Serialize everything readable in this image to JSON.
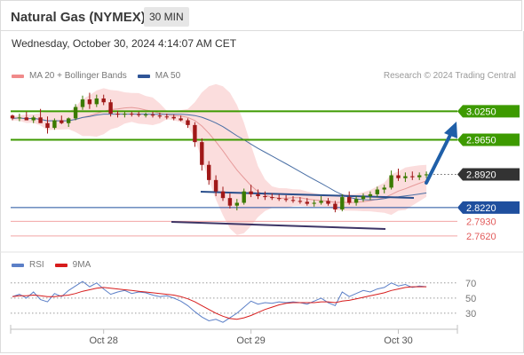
{
  "header": {
    "title": "Natural Gas (NYMEX)",
    "interval": "30 MIN"
  },
  "timestamp": "Wednesday, October 30, 2024 4:14:07 AM CET",
  "legend": {
    "ma20_label": "MA 20 + Bollinger Bands",
    "ma50_label": "MA 50",
    "credit": "Research © 2024 Trading Central"
  },
  "rsi_legend": {
    "rsi_label": "RSI",
    "ma_label": "9MA"
  },
  "colors": {
    "resistance": "#3d9a00",
    "support": "#1f4f9e",
    "secondary_support": "#e25c5c",
    "bollinger_fill": "#fad2d2",
    "ma20": "#e69a9a",
    "ma50": "#4a6fa5",
    "arrow": "#1f5fa8",
    "candle_up": "#3a7a00",
    "candle_down": "#a01818",
    "rsi_line": "#5b7fc7",
    "rsi_ma": "#d71c1c"
  },
  "chart_data": [
    {
      "type": "line",
      "subtype": "candlestick",
      "x_ticks": [
        "Oct 28",
        "Oct 29",
        "Oct 30"
      ],
      "ylim": [
        2.73,
        3.08
      ],
      "levels": [
        {
          "label": "3.0250",
          "value": 3.025,
          "kind": "resistance"
        },
        {
          "label": "2.9650",
          "value": 2.965,
          "kind": "resistance"
        },
        {
          "label": "2.8920",
          "value": 2.892,
          "kind": "last"
        },
        {
          "label": "2.8220",
          "value": 2.822,
          "kind": "support"
        },
        {
          "label": "2.7930",
          "value": 2.793,
          "kind": "secondary_support"
        },
        {
          "label": "2.7620",
          "value": 2.762,
          "kind": "secondary_support"
        }
      ],
      "candles": [
        [
          0,
          3.016,
          3.018,
          3.006,
          3.01
        ],
        [
          1,
          3.01,
          3.02,
          3.004,
          3.012
        ],
        [
          2,
          3.012,
          3.024,
          3.006,
          3.006
        ],
        [
          3,
          3.006,
          3.016,
          3.0,
          3.012
        ],
        [
          4,
          3.012,
          3.03,
          3.008,
          3.0
        ],
        [
          5,
          3.0,
          3.014,
          2.978,
          2.99
        ],
        [
          6,
          2.99,
          3.01,
          2.986,
          3.006
        ],
        [
          7,
          3.006,
          3.016,
          2.998,
          3.0
        ],
        [
          8,
          3.0,
          3.012,
          2.992,
          3.01
        ],
        [
          9,
          3.01,
          3.04,
          3.006,
          3.034
        ],
        [
          10,
          3.034,
          3.058,
          3.028,
          3.05
        ],
        [
          11,
          3.05,
          3.064,
          3.03,
          3.04
        ],
        [
          12,
          3.04,
          3.06,
          3.034,
          3.052
        ],
        [
          13,
          3.052,
          3.06,
          3.038,
          3.044
        ],
        [
          14,
          3.044,
          3.05,
          3.014,
          3.02
        ],
        [
          15,
          3.02,
          3.026,
          3.012,
          3.018
        ],
        [
          16,
          3.018,
          3.024,
          3.012,
          3.02
        ],
        [
          17,
          3.02,
          3.024,
          3.014,
          3.019
        ],
        [
          18,
          3.019,
          3.024,
          3.013,
          3.017
        ],
        [
          19,
          3.017,
          3.022,
          3.012,
          3.018
        ],
        [
          20,
          3.018,
          3.024,
          3.012,
          3.016
        ],
        [
          21,
          3.016,
          3.022,
          3.01,
          3.014
        ],
        [
          22,
          3.014,
          3.02,
          3.008,
          3.013
        ],
        [
          23,
          3.013,
          3.018,
          3.006,
          3.01
        ],
        [
          24,
          3.01,
          3.016,
          3.004,
          3.006
        ],
        [
          25,
          3.006,
          3.01,
          2.99,
          2.996
        ],
        [
          26,
          2.996,
          3.002,
          2.95,
          2.96
        ],
        [
          27,
          2.96,
          2.968,
          2.9,
          2.912
        ],
        [
          28,
          2.912,
          2.92,
          2.87,
          2.88
        ],
        [
          29,
          2.88,
          2.89,
          2.846,
          2.856
        ],
        [
          30,
          2.856,
          2.866,
          2.836,
          2.842
        ],
        [
          31,
          2.842,
          2.852,
          2.82,
          2.826
        ],
        [
          32,
          2.826,
          2.84,
          2.816,
          2.832
        ],
        [
          33,
          2.832,
          2.862,
          2.828,
          2.856
        ],
        [
          34,
          2.856,
          2.87,
          2.844,
          2.85
        ],
        [
          35,
          2.85,
          2.86,
          2.84,
          2.846
        ],
        [
          36,
          2.846,
          2.856,
          2.838,
          2.844
        ],
        [
          37,
          2.844,
          2.852,
          2.838,
          2.842
        ],
        [
          38,
          2.842,
          2.85,
          2.836,
          2.84
        ],
        [
          39,
          2.84,
          2.848,
          2.834,
          2.838
        ],
        [
          40,
          2.838,
          2.846,
          2.832,
          2.836
        ],
        [
          41,
          2.836,
          2.844,
          2.83,
          2.834
        ],
        [
          42,
          2.834,
          2.842,
          2.826,
          2.83
        ],
        [
          43,
          2.83,
          2.838,
          2.824,
          2.832
        ],
        [
          44,
          2.832,
          2.846,
          2.828,
          2.836
        ],
        [
          45,
          2.836,
          2.842,
          2.826,
          2.83
        ],
        [
          46,
          2.83,
          2.836,
          2.812,
          2.818
        ],
        [
          47,
          2.818,
          2.85,
          2.814,
          2.844
        ],
        [
          48,
          2.844,
          2.856,
          2.828,
          2.832
        ],
        [
          49,
          2.832,
          2.846,
          2.826,
          2.84
        ],
        [
          50,
          2.84,
          2.852,
          2.834,
          2.846
        ],
        [
          51,
          2.846,
          2.856,
          2.838,
          2.85
        ],
        [
          52,
          2.85,
          2.866,
          2.844,
          2.86
        ],
        [
          53,
          2.86,
          2.87,
          2.852,
          2.864
        ],
        [
          54,
          2.864,
          2.9,
          2.86,
          2.89
        ],
        [
          55,
          2.89,
          2.904,
          2.878,
          2.884
        ],
        [
          56,
          2.884,
          2.896,
          2.876,
          2.888
        ],
        [
          57,
          2.888,
          2.898,
          2.88,
          2.886
        ],
        [
          58,
          2.886,
          2.896,
          2.88,
          2.89
        ],
        [
          59,
          2.89,
          2.898,
          2.884,
          2.892
        ]
      ]
    },
    {
      "type": "line",
      "title": "RSI",
      "ylim": [
        10,
        85
      ],
      "y_ticks": [
        70,
        50,
        30
      ],
      "series": [
        {
          "name": "RSI",
          "values": [
            52,
            55,
            50,
            58,
            48,
            45,
            56,
            52,
            60,
            66,
            72,
            65,
            70,
            62,
            55,
            58,
            60,
            56,
            58,
            57,
            54,
            52,
            53,
            50,
            46,
            40,
            32,
            25,
            20,
            22,
            18,
            24,
            30,
            38,
            46,
            42,
            44,
            43,
            45,
            44,
            45,
            44,
            42,
            46,
            50,
            44,
            40,
            58,
            52,
            56,
            60,
            58,
            62,
            64,
            70,
            66,
            68,
            64,
            66,
            65
          ]
        },
        {
          "name": "9MA",
          "values": [
            52,
            53,
            53,
            54,
            53,
            52,
            52,
            53,
            54,
            56,
            59,
            61,
            63,
            64,
            63,
            62,
            61,
            60,
            59,
            58,
            57,
            56,
            55,
            54,
            52,
            49,
            45,
            40,
            35,
            30,
            26,
            23,
            22,
            24,
            27,
            31,
            35,
            38,
            41,
            43,
            44,
            44,
            44,
            44,
            45,
            45,
            44,
            46,
            47,
            49,
            51,
            53,
            55,
            57,
            60,
            62,
            64,
            65,
            65,
            65
          ]
        }
      ]
    }
  ]
}
